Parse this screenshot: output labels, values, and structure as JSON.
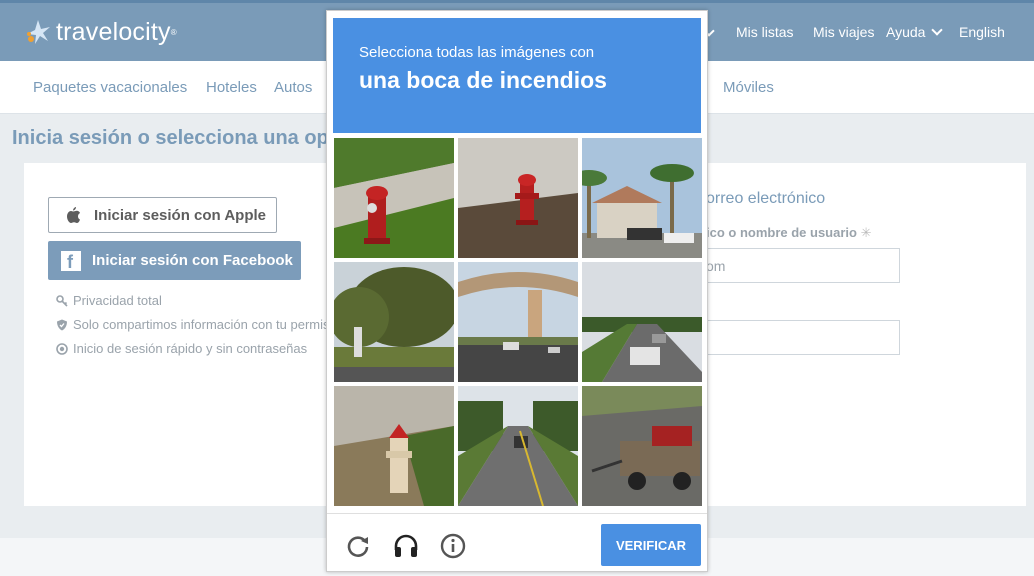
{
  "brand": {
    "name": "travelocity",
    "tm": "®"
  },
  "topnav": {
    "my_lists": "Mis listas",
    "my_trips": "Mis viajes",
    "help": "Ayuda",
    "language": "English"
  },
  "subnav": [
    "Paquetes vacacionales",
    "Hoteles",
    "Autos",
    "Móviles"
  ],
  "page": {
    "heading": "Inicia sesión o selecciona una op"
  },
  "social": {
    "apple_label": "Iniciar sesión con Apple",
    "facebook_label": "Iniciar sesión con Facebook",
    "fb_glyph": "f"
  },
  "perks": [
    {
      "icon": "key-icon",
      "text": "Privacidad total"
    },
    {
      "icon": "shield-icon",
      "text": "Solo compartimos información con tu permis"
    },
    {
      "icon": "target-icon",
      "text": "Inicio de sesión rápido y sin contraseñas"
    }
  ],
  "email_form": {
    "title": "orreo electrónico",
    "label": "ico o nombre de usuario",
    "required_mark": "✳",
    "email_value": "om",
    "password_value": ""
  },
  "captcha": {
    "instruction": "Selecciona todas las imágenes con",
    "target": "una boca de incendios",
    "verify_label": "VERIFICAR",
    "reload_icon": "reload-icon",
    "audio_icon": "headphones-icon",
    "info_icon": "info-icon",
    "tiles": [
      {
        "name": "tile-hydrant-curb"
      },
      {
        "name": "tile-hydrant-concrete"
      },
      {
        "name": "tile-palm-house"
      },
      {
        "name": "tile-trees-road"
      },
      {
        "name": "tile-overpass"
      },
      {
        "name": "tile-highway-cars"
      },
      {
        "name": "tile-hydrant-grass"
      },
      {
        "name": "tile-forest-road"
      },
      {
        "name": "tile-trailer-road"
      }
    ]
  },
  "colors": {
    "header": "#7a9bb8",
    "captcha_blue": "#4a90e2",
    "facebook": "#7c9cba"
  }
}
